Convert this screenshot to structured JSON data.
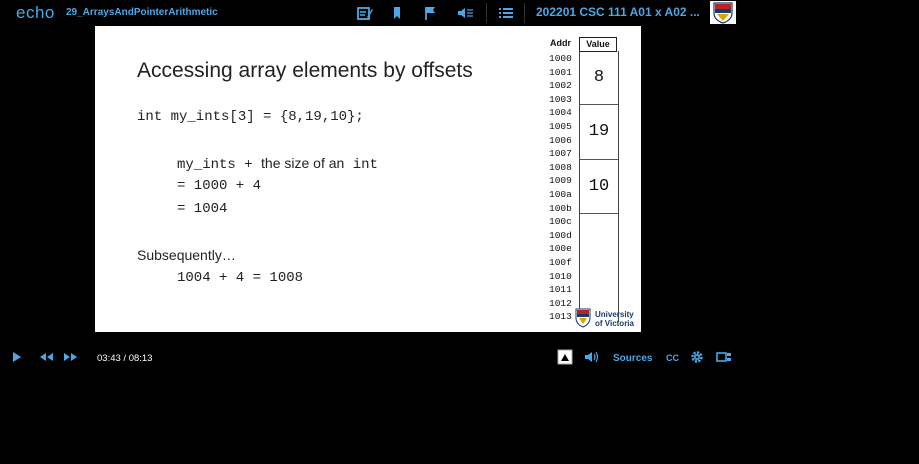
{
  "topbar": {
    "logo": "echo",
    "recording_title": "29_ArraysAndPointerArithmetic",
    "course_title": "202201 CSC 111 A01 x A02 ..."
  },
  "slide": {
    "title": "Accessing array elements by offsets",
    "decl": "int my_ints[3] = {8,19,10};",
    "expr_var": "my_ints + ",
    "expr_text": "the size of an",
    "expr_type": " int",
    "line2": "= 1000 + 4",
    "line3": "= 1004",
    "subsequently": "Subsequently…",
    "line4": "1004 + 4 = 1008",
    "table": {
      "addr_header": "Addr",
      "value_header": "Value",
      "addresses": [
        "1000",
        "1001",
        "1002",
        "1003",
        "1004",
        "1005",
        "1006",
        "1007",
        "1008",
        "1009",
        "100a",
        "100b",
        "100c",
        "100d",
        "100e",
        "100f",
        "1010",
        "1011",
        "1012",
        "1013"
      ],
      "values": [
        "8",
        "19",
        "10"
      ]
    },
    "university": "University\nof Victoria"
  },
  "player": {
    "time": "03:43 / 08:13",
    "sources_label": "Sources",
    "cc_label": "CC"
  },
  "colors": {
    "accent": "#4aa8e8",
    "background": "#000000",
    "slide_bg": "#ffffff"
  }
}
